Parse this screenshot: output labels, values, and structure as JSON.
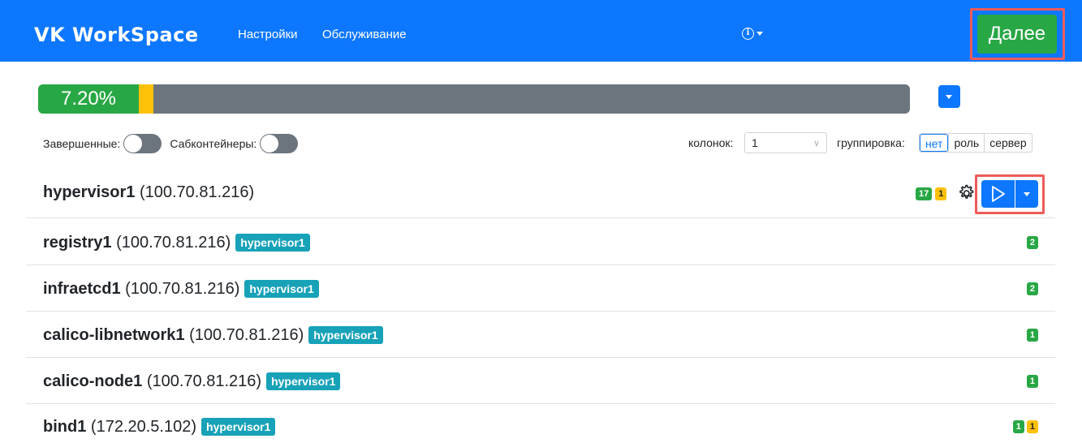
{
  "header": {
    "brand": "VK WorkSpace",
    "nav": [
      "Настройки",
      "Обслуживание"
    ],
    "info_icon": "info-circle-icon",
    "next_label": "Далее",
    "accent": "#0d77ff",
    "next_color": "#28a745"
  },
  "progress": {
    "label": "7.20%",
    "success_fraction": 0.072,
    "warning_fraction": 0.0165,
    "success_color": "#28a745",
    "warning_color": "#ffc107",
    "rest_color": "#6c757d"
  },
  "filters": {
    "completed_label": "Завершенные:",
    "completed_on": false,
    "subcontainers_label": "Сабконтейнеры:",
    "subcontainers_on": false,
    "columns_label": "колонок:",
    "columns_value": "1",
    "grouping_label": "группировка:",
    "grouping_options": [
      "нет",
      "роль",
      "сервер"
    ],
    "grouping_selected": "нет"
  },
  "host": {
    "name": "hypervisor1",
    "ip": "(100.70.81.216)",
    "badges": [
      {
        "value": "17",
        "color": "green"
      },
      {
        "value": "1",
        "color": "yellow"
      }
    ]
  },
  "containers": [
    {
      "name": "registry1",
      "ip": "(100.70.81.216)",
      "tag": "hypervisor1",
      "badges": [
        {
          "value": "2",
          "color": "green"
        }
      ]
    },
    {
      "name": "infraetcd1",
      "ip": "(100.70.81.216)",
      "tag": "hypervisor1",
      "badges": [
        {
          "value": "2",
          "color": "green"
        }
      ]
    },
    {
      "name": "calico-libnetwork1",
      "ip": "(100.70.81.216)",
      "tag": "hypervisor1",
      "badges": [
        {
          "value": "1",
          "color": "green"
        }
      ]
    },
    {
      "name": "calico-node1",
      "ip": "(100.70.81.216)",
      "tag": "hypervisor1",
      "badges": [
        {
          "value": "1",
          "color": "green"
        }
      ]
    },
    {
      "name": "bind1",
      "ip": "(172.20.5.102)",
      "tag": "hypervisor1",
      "badges": [
        {
          "value": "1",
          "color": "green"
        },
        {
          "value": "1",
          "color": "yellow"
        }
      ]
    }
  ]
}
